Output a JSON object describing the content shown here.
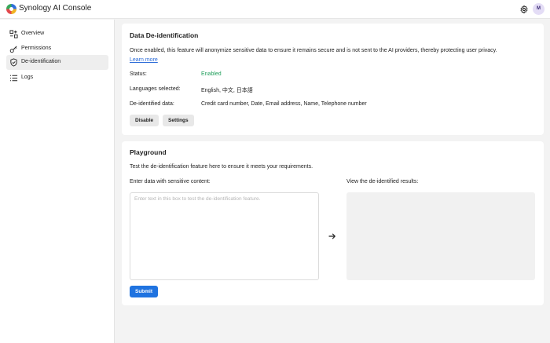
{
  "app": {
    "title": "Synology AI Console",
    "user_initial": "M"
  },
  "header": {
    "icons": [
      "gear-icon",
      "avatar"
    ]
  },
  "sidebar": {
    "items": [
      {
        "label": "Overview",
        "icon": "overview-icon"
      },
      {
        "label": "Permissions",
        "icon": "key-icon"
      },
      {
        "label": "De-identification",
        "icon": "shield-icon",
        "active": true
      },
      {
        "label": "Logs",
        "icon": "list-icon"
      }
    ]
  },
  "deid": {
    "title": "Data De-identification",
    "description": "Once enabled, this feature will anonymize sensitive data to ensure it remains secure and is not sent to the AI providers, thereby protecting user privacy.",
    "learn_more": "Learn more",
    "status_label": "Status:",
    "status_value": "Enabled",
    "languages_label": "Languages selected:",
    "languages_value": "English, 中文, 日本語",
    "data_label": "De-identified data:",
    "data_value": "Credit card number, Date, Email address, Name, Telephone number",
    "disable_label": "Disable",
    "settings_label": "Settings"
  },
  "playground": {
    "title": "Playground",
    "intro": "Test the de-identification feature here to ensure it meets your requirements.",
    "input_label": "Enter data with sensitive content:",
    "input_placeholder": "Enter text in this box to test the de-identification feature.",
    "input_value": "",
    "results_label": "View the de-identified results:",
    "submit_label": "Submit"
  },
  "colors": {
    "accent": "#1f73e0",
    "status_enabled": "#1e9e5a",
    "link": "#2a6ad8"
  }
}
